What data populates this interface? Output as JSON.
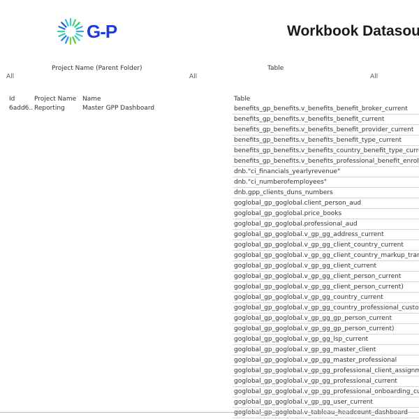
{
  "header": {
    "logo_text": "G-P",
    "title": "Workbook Datasou"
  },
  "filters": {
    "project_label": "Project Name (Parent Folder)",
    "project_value": "All",
    "middle_value": "All",
    "table_label": "Table",
    "table_value": "All"
  },
  "columns": {
    "id": "Id",
    "project_name": "Project Name",
    "name": "Name",
    "table": "Table"
  },
  "row": {
    "id": "6add6..",
    "project_name": "Reporting",
    "name": "Master GPP Dashboard"
  },
  "tables": [
    "benefits_gp_benefits.v_benefits_benefit_broker_current",
    "benefits_gp_benefits.v_benefits_benefit_current",
    "benefits_gp_benefits.v_benefits_benefit_provider_current",
    "benefits_gp_benefits.v_benefits_benefit_type_current",
    "benefits_gp_benefits.v_benefits_country_benefit_type_curre",
    "benefits_gp_benefits.v_benefits_professional_benefit_enrollı",
    "dnb.\"ci_financials_yearlyrevenue\"",
    "dnb.\"ci_numberofemployees\"",
    "dnb.gpp_clients_duns_numbers",
    "goglobal_gp_goglobal.client_person_aud",
    "goglobal_gp_goglobal.price_books",
    "goglobal_gp_goglobal.professional_aud",
    "goglobal_gp_goglobal.v_gp_gg_address_current",
    "goglobal_gp_goglobal.v_gp_gg_client_country_current",
    "goglobal_gp_goglobal.v_gp_gg_client_country_markup_trans",
    "goglobal_gp_goglobal.v_gp_gg_client_current",
    "goglobal_gp_goglobal.v_gp_gg_client_person_current",
    "goglobal_gp_goglobal.v_gp_gg_client_person_current)",
    "goglobal_gp_goglobal.v_gp_gg_country_current",
    "goglobal_gp_goglobal.v_gp_gg_country_professional_custom",
    "goglobal_gp_goglobal.v_gp_gg_gp_person_current",
    "goglobal_gp_goglobal.v_gp_gg_gp_person_current)",
    "goglobal_gp_goglobal.v_gp_gg_lsp_current",
    "goglobal_gp_goglobal.v_gp_gg_master_client",
    "goglobal_gp_goglobal.v_gp_gg_master_professional",
    "goglobal_gp_goglobal.v_gp_gg_professional_client_assignme",
    "goglobal_gp_goglobal.v_gp_gg_professional_current",
    "goglobal_gp_goglobal.v_gp_gg_professional_onboarding_cur",
    "goglobal_gp_goglobal.v_gp_gg_user_current",
    "goglobal_gp_goglobal.v_tableau_headcount_dashboard"
  ]
}
